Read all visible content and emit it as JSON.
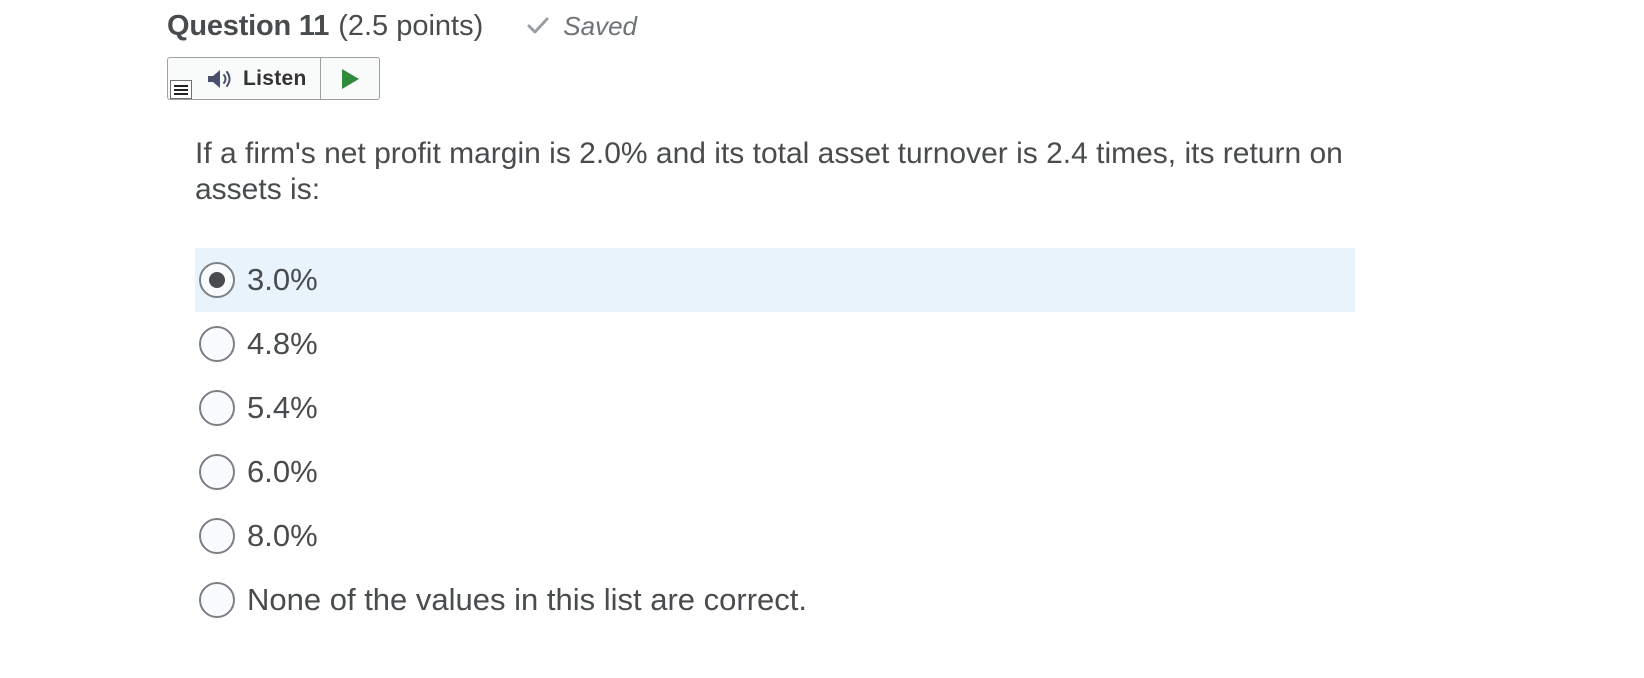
{
  "question": {
    "title": "Question 11",
    "points": "(2.5 points)",
    "saved_label": "Saved",
    "saved_icon": "check-icon",
    "text": "If a firm's net profit margin is 2.0% and its total asset turnover is 2.4 times, its return on assets is:"
  },
  "listen": {
    "label": "Listen",
    "menu_icon": "menu-icon",
    "speaker_icon": "speaker-icon",
    "play_icon": "play-icon",
    "play_color": "#2e8b3a"
  },
  "options": [
    {
      "label": "3.0%",
      "selected": true
    },
    {
      "label": "4.8%",
      "selected": false
    },
    {
      "label": "5.4%",
      "selected": false
    },
    {
      "label": "6.0%",
      "selected": false
    },
    {
      "label": "8.0%",
      "selected": false
    },
    {
      "label": "None of the values in this list are correct.",
      "selected": false
    }
  ],
  "colors": {
    "selected_bg": "#e8f3fc",
    "text": "#494c4e"
  }
}
